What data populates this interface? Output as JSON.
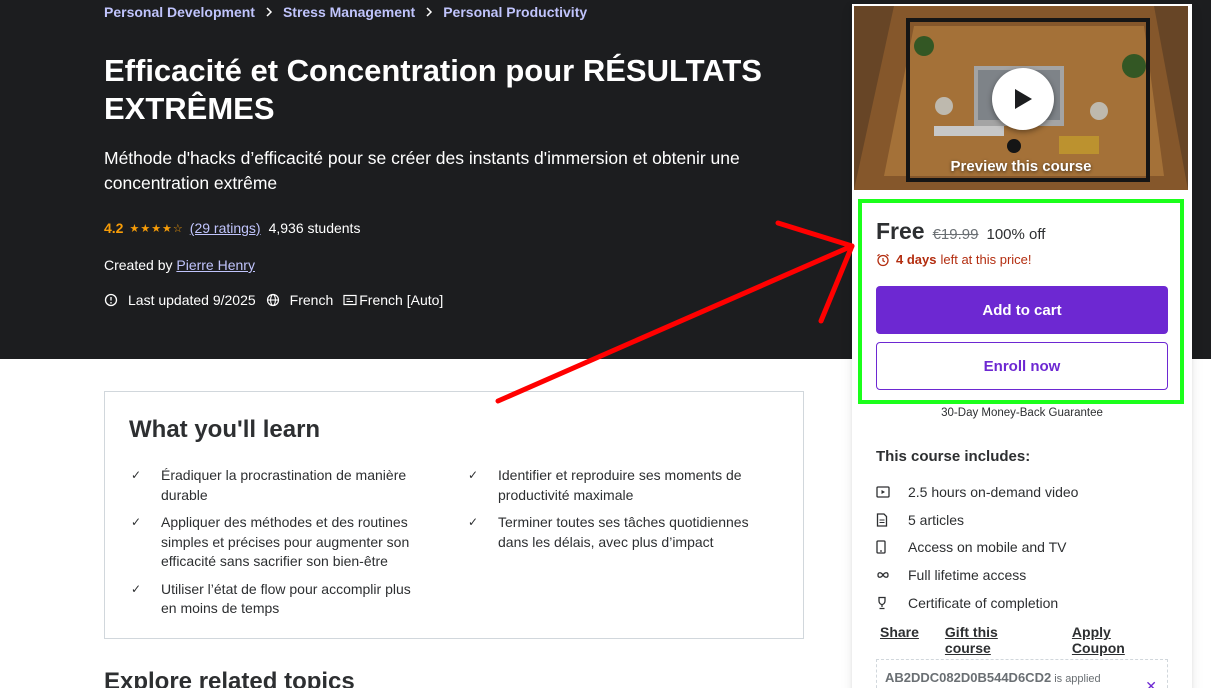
{
  "breadcrumb": [
    "Personal Development",
    "Stress Management",
    "Personal Productivity"
  ],
  "course": {
    "title": "Efficacité et Concentration pour RÉSULTATS EXTRÊMES",
    "subtitle": "Méthode d'hacks d’efficacité pour se créer des instants d'immersion et obtenir une concentration extrême",
    "rating": "4.2",
    "stars": 4.2,
    "ratings_count": "(29 ratings)",
    "students": "4,936 students",
    "created_label": "Created by",
    "author": "Pierre Henry",
    "last_updated": "Last updated 9/2025",
    "language": "French",
    "captions": "French [Auto]"
  },
  "learn": {
    "title": "What you'll learn",
    "items_left": [
      "Éradiquer la procrastination de manière durable",
      "Appliquer des méthodes et des routines simples et précises pour augmenter son efficacité sans sacrifier son bien-être",
      "Utiliser l’état de flow pour accomplir plus en moins de temps"
    ],
    "items_right": [
      "Identifier et reproduire ses moments de productivité maximale",
      "Terminer toutes ses tâches quotidiennes dans les délais, avec plus d’impact"
    ]
  },
  "explore_title": "Explore related topics",
  "sidebar": {
    "preview_label": "Preview this course",
    "price": "Free",
    "original_price": "€19.99",
    "discount": "100% off",
    "countdown_days": "4 days",
    "countdown_rest": "left at this price!",
    "add_to_cart": "Add to cart",
    "enroll_now": "Enroll now",
    "guarantee": "30-Day Money-Back Guarantee",
    "includes_title": "This course includes:",
    "includes": [
      {
        "icon": "video-icon",
        "label": "2.5 hours on-demand video"
      },
      {
        "icon": "article-icon",
        "label": "5 articles"
      },
      {
        "icon": "mobile-icon",
        "label": "Access on mobile and TV"
      },
      {
        "icon": "infinity-icon",
        "label": "Full lifetime access"
      },
      {
        "icon": "trophy-icon",
        "label": "Certificate of completion"
      }
    ],
    "links": [
      "Share",
      "Gift this course",
      "Apply Coupon"
    ],
    "coupon_code": "AB2DDC082D0B544D6CD2",
    "coupon_status": "is applied"
  },
  "colors": {
    "hero_bg": "#1c1d1f",
    "accent": "#6d28d2",
    "link": "#c0c4fc",
    "star": "#f69c08",
    "highlight_box": "#1bff1b",
    "annotation_arrow": "#ff0000"
  }
}
